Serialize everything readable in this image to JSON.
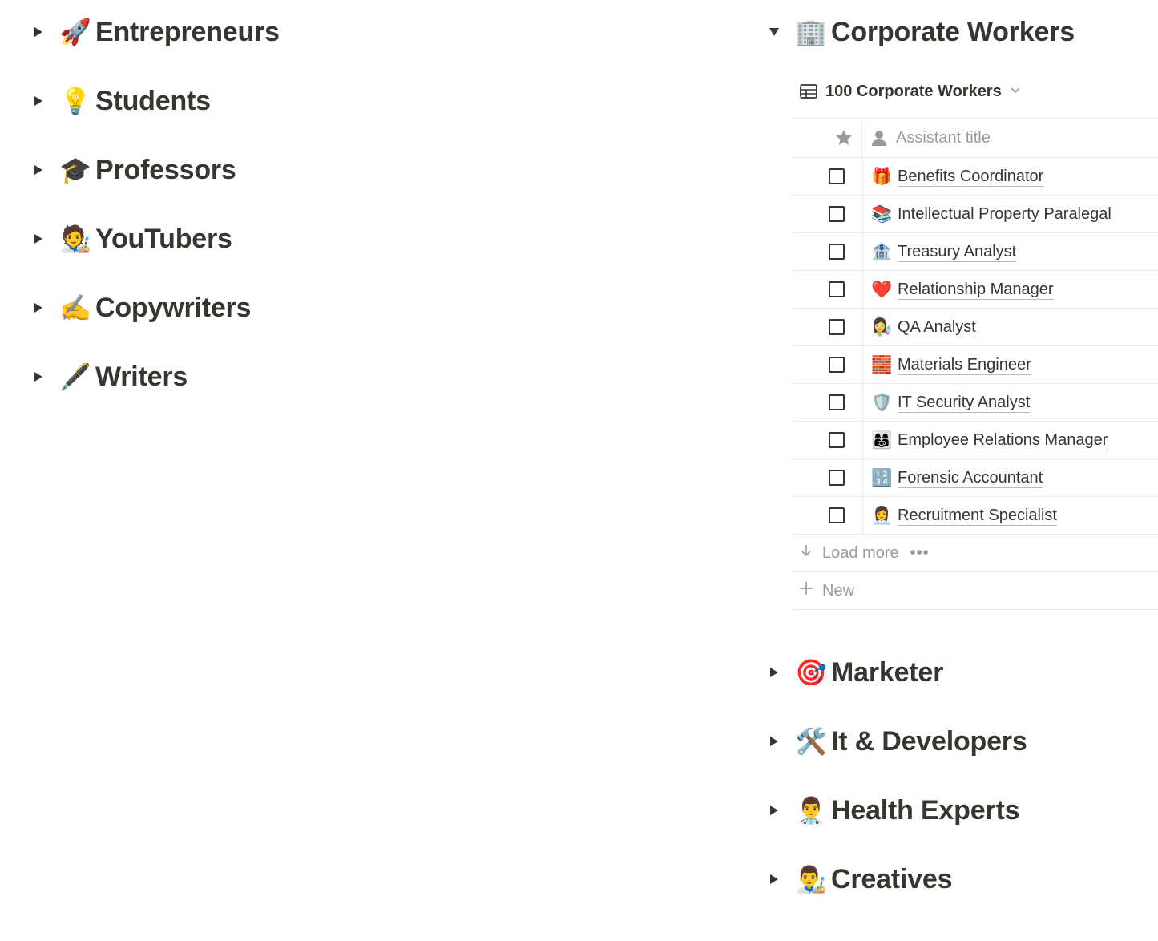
{
  "left_toggles": [
    {
      "emoji": "🚀",
      "label": "Entrepreneurs"
    },
    {
      "emoji": "💡",
      "label": "Students"
    },
    {
      "emoji": "🎓",
      "label": "Professors"
    },
    {
      "emoji": "🧑‍🎨",
      "label": "YouTubers"
    },
    {
      "emoji": "✍️",
      "label": "Copywriters"
    },
    {
      "emoji": "🖋️",
      "label": "Writers"
    }
  ],
  "corporate": {
    "emoji": "🏢",
    "label": "Corporate Workers",
    "view_title": "100 Corporate Workers",
    "column_header": "Assistant title",
    "rows": [
      {
        "emoji": "🎁",
        "label": "Benefits Coordinator"
      },
      {
        "emoji": "📚",
        "label": "Intellectual Property Paralegal"
      },
      {
        "emoji": "🏦",
        "label": "Treasury Analyst"
      },
      {
        "emoji": "❤️",
        "label": "Relationship Manager"
      },
      {
        "emoji": "👩‍🔬",
        "label": "QA Analyst"
      },
      {
        "emoji": "🧱",
        "label": "Materials Engineer"
      },
      {
        "emoji": "🛡️",
        "label": "IT Security Analyst"
      },
      {
        "emoji": "👩‍👩‍👧",
        "label": "Employee Relations Manager"
      },
      {
        "emoji": "🔢",
        "label": "Forensic Accountant"
      },
      {
        "emoji": "👩‍💼",
        "label": "Recruitment Specialist"
      }
    ],
    "load_more": "Load more",
    "new_label": "New"
  },
  "right_toggles": [
    {
      "emoji": "🎯",
      "label": "Marketer"
    },
    {
      "emoji": "🛠️",
      "label": "It & Developers"
    },
    {
      "emoji": "👨‍⚕️",
      "label": "Health Experts"
    },
    {
      "emoji": "👨‍🎨",
      "label": "Creatives"
    }
  ],
  "colors": {
    "text": "#37352f",
    "muted": "#9b9a97",
    "border": "#ececeb"
  }
}
